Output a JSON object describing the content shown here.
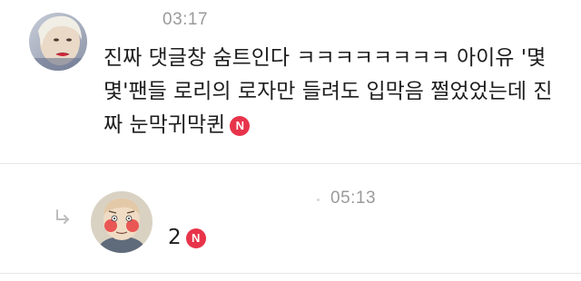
{
  "comments": [
    {
      "time": "03:17",
      "text": "진짜 댓글창 숨트인다 ㅋㅋㅋㅋㅋㅋㅋㅋ 아이유 '몇몇'팬들 로리의 로자만 들려도 입막음 쩔었었는데 진짜 눈막귀막퀸",
      "badge": "N"
    }
  ],
  "reply": {
    "time": "05:13",
    "text": "2",
    "badge": "N"
  },
  "colors": {
    "badge": "#e8344a",
    "timestamp": "#9a9a9a",
    "divider": "#e6e6e6"
  },
  "icons": {
    "reply_indicator": "reply-arrow-icon",
    "new_badge": "new-badge-icon"
  }
}
